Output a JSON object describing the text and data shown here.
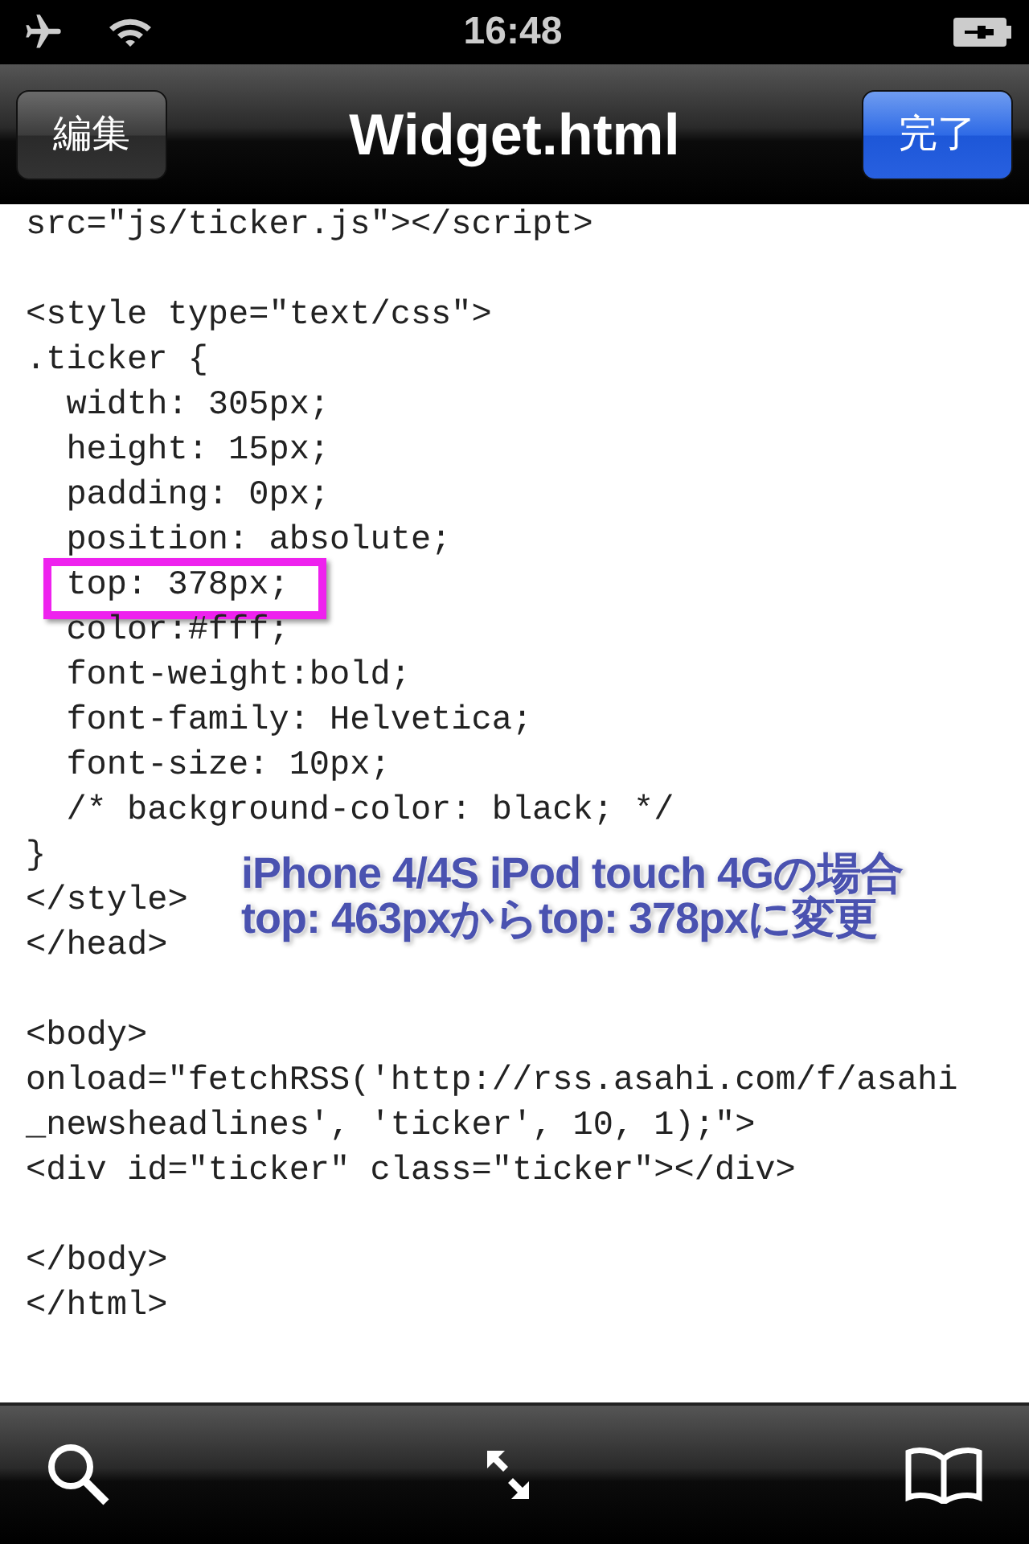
{
  "status_bar": {
    "time": "16:48"
  },
  "nav_bar": {
    "left_button": "編集",
    "title": "Widget.html",
    "right_button": "完了"
  },
  "code_lines": [
    {
      "kind": "text",
      "text": "src=\"js/ticker.js\"></script>",
      "highlighted": false
    },
    {
      "kind": "blank"
    },
    {
      "kind": "text",
      "text": "<style type=\"text/css\">",
      "highlighted": false
    },
    {
      "kind": "text",
      "text": ".ticker {",
      "highlighted": false
    },
    {
      "kind": "text",
      "text": "  width: 305px;",
      "highlighted": false
    },
    {
      "kind": "text",
      "text": "  height: 15px;",
      "highlighted": false
    },
    {
      "kind": "text",
      "text": "  padding: 0px;",
      "highlighted": false
    },
    {
      "kind": "text",
      "text": "  position: absolute;",
      "highlighted": false
    },
    {
      "kind": "text",
      "text": "  top: 378px;",
      "highlighted": true
    },
    {
      "kind": "text",
      "text": "  color:#fff;",
      "highlighted": false
    },
    {
      "kind": "text",
      "text": "  font-weight:bold;",
      "highlighted": false
    },
    {
      "kind": "text",
      "text": "  font-family: Helvetica;",
      "highlighted": false
    },
    {
      "kind": "text",
      "text": "  font-size: 10px;",
      "highlighted": false
    },
    {
      "kind": "text",
      "text": "  /* background-color: black; */",
      "highlighted": false
    },
    {
      "kind": "text",
      "text": "}",
      "highlighted": false
    },
    {
      "kind": "text",
      "text": "</style>",
      "highlighted": false
    },
    {
      "kind": "text",
      "text": "</head>",
      "highlighted": false
    },
    {
      "kind": "blank"
    },
    {
      "kind": "text",
      "text": "<body>",
      "highlighted": false
    },
    {
      "kind": "text",
      "text": "onload=\"fetchRSS('http://rss.asahi.com/f/asahi",
      "highlighted": false
    },
    {
      "kind": "text",
      "text": "_newsheadlines', 'ticker', 10, 1);\">",
      "highlighted": false
    },
    {
      "kind": "text",
      "text": "<div id=\"ticker\" class=\"ticker\"></div>",
      "highlighted": false
    },
    {
      "kind": "blank"
    },
    {
      "kind": "text",
      "text": "</body>",
      "highlighted": false
    },
    {
      "kind": "text",
      "text": "</html>",
      "highlighted": false
    }
  ],
  "annotation": [
    "iPhone 4/4S iPod touch 4Gの場合",
    "top: 463pxからtop: 378pxに変更"
  ]
}
